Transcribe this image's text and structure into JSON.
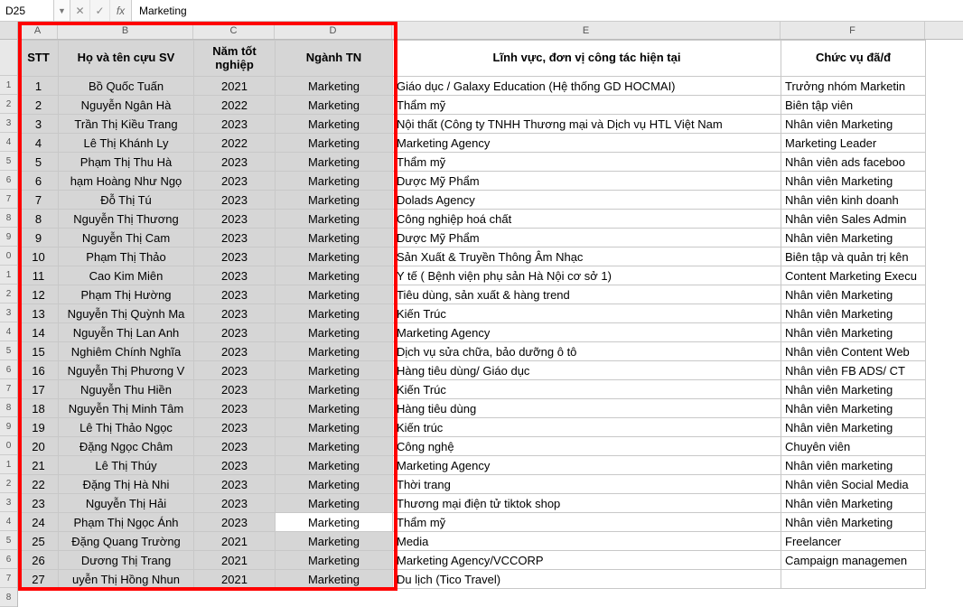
{
  "formula_bar": {
    "cell_ref": "D25",
    "fx_label": "fx",
    "value": "Marketing"
  },
  "columns": [
    "A",
    "B",
    "C",
    "D",
    "E",
    "F"
  ],
  "row_numbers": [
    "",
    "1",
    "2",
    "3",
    "4",
    "5",
    "6",
    "7",
    "8",
    "9",
    "0",
    "1",
    "2",
    "3",
    "4",
    "5",
    "6",
    "7",
    "8",
    "9",
    "0",
    "1",
    "2",
    "3",
    "4",
    "5",
    "6",
    "7",
    "8"
  ],
  "headers": {
    "stt": "STT",
    "name": "Họ và tên cựu SV",
    "year": "Năm tốt nghiệp",
    "major": "Ngành TN",
    "field": "Lĩnh vực, đơn vị công tác hiện tại",
    "position": "Chức vụ đã/đ"
  },
  "rows": [
    {
      "stt": "1",
      "name": "Bồ Quốc Tuấn",
      "year": "2021",
      "major": "Marketing",
      "field": "Giáo dục / Galaxy Education (Hệ thống GD HOCMAI)",
      "pos": "Trưởng nhóm Marketin"
    },
    {
      "stt": "2",
      "name": "Nguyễn Ngân Hà",
      "year": "2022",
      "major": "Marketing",
      "field": "Thẩm mỹ",
      "pos": "Biên tập viên"
    },
    {
      "stt": "3",
      "name": "Trần Thị Kiều Trang",
      "year": "2023",
      "major": "Marketing",
      "field": "Nội thất (Công ty TNHH Thương mại và Dịch vụ HTL Việt Nam",
      "pos": "Nhân viên Marketing"
    },
    {
      "stt": "4",
      "name": "Lê Thị Khánh Ly",
      "year": "2022",
      "major": "Marketing",
      "field": "Marketing Agency",
      "pos": "Marketing Leader"
    },
    {
      "stt": "5",
      "name": "Phạm Thị Thu Hà",
      "year": "2023",
      "major": "Marketing",
      "field": "Thẩm mỹ",
      "pos": "Nhân viên ads faceboo"
    },
    {
      "stt": "6",
      "name": "hạm Hoàng Như Ngọ",
      "year": "2023",
      "major": "Marketing",
      "field": "Dược Mỹ Phẩm",
      "pos": "Nhân viên Marketing"
    },
    {
      "stt": "7",
      "name": "Đỗ Thị Tú",
      "year": "2023",
      "major": "Marketing",
      "field": "Dolads Agency",
      "pos": "Nhân viên kinh doanh"
    },
    {
      "stt": "8",
      "name": "Nguyễn Thị Thương",
      "year": "2023",
      "major": "Marketing",
      "field": "Công nghiệp hoá chất",
      "pos": "Nhân viên Sales Admin"
    },
    {
      "stt": "9",
      "name": "Nguyễn Thị Cam",
      "year": "2023",
      "major": "Marketing",
      "field": "Dược Mỹ Phẩm",
      "pos": "Nhân viên Marketing"
    },
    {
      "stt": "10",
      "name": "Phạm Thị Thảo",
      "year": "2023",
      "major": "Marketing",
      "field": "Sản Xuất & Truyền Thông Âm Nhạc",
      "pos": "Biên tập và quản trị kên"
    },
    {
      "stt": "11",
      "name": "Cao Kim Miên",
      "year": "2023",
      "major": "Marketing",
      "field": "Y tế ( Bệnh viện phụ sản Hà Nội cơ sở 1)",
      "pos": "Content Marketing Execu"
    },
    {
      "stt": "12",
      "name": "Phạm Thị Hường",
      "year": "2023",
      "major": "Marketing",
      "field": "Tiêu dùng, sản xuất & hàng trend",
      "pos": "Nhân viên Marketing"
    },
    {
      "stt": "13",
      "name": "Nguyễn Thị Quỳnh Ma",
      "year": "2023",
      "major": "Marketing",
      "field": "Kiến Trúc",
      "pos": "Nhân viên Marketing"
    },
    {
      "stt": "14",
      "name": "Nguyễn Thị Lan Anh",
      "year": "2023",
      "major": "Marketing",
      "field": "Marketing Agency",
      "pos": "Nhân viên Marketing"
    },
    {
      "stt": "15",
      "name": "Nghiêm Chính Nghĩa",
      "year": "2023",
      "major": "Marketing",
      "field": "Dịch vụ sửa chữa, bảo dưỡng ô tô",
      "pos": "Nhân viên Content Web"
    },
    {
      "stt": "16",
      "name": "Nguyễn Thị Phương V",
      "year": "2023",
      "major": "Marketing",
      "field": "Hàng tiêu dùng/ Giáo dục",
      "pos": "Nhân viên FB ADS/ CT"
    },
    {
      "stt": "17",
      "name": "Nguyễn Thu Hiền",
      "year": "2023",
      "major": "Marketing",
      "field": "Kiến Trúc",
      "pos": "Nhân viên Marketing"
    },
    {
      "stt": "18",
      "name": "Nguyễn Thị Minh Tâm",
      "year": "2023",
      "major": "Marketing",
      "field": "Hàng tiêu dùng",
      "pos": "Nhân viên Marketing"
    },
    {
      "stt": "19",
      "name": "Lê Thị Thảo Ngọc",
      "year": "2023",
      "major": "Marketing",
      "field": "Kiến trúc",
      "pos": "Nhân viên Marketing"
    },
    {
      "stt": "20",
      "name": "Đặng Ngọc Châm",
      "year": "2023",
      "major": "Marketing",
      "field": "Công nghệ",
      "pos": "Chuyên viên"
    },
    {
      "stt": "21",
      "name": "Lê Thị Thúy",
      "year": "2023",
      "major": "Marketing",
      "field": "Marketing Agency",
      "pos": "Nhân viên marketing"
    },
    {
      "stt": "22",
      "name": "Đặng Thị Hà Nhi",
      "year": "2023",
      "major": "Marketing",
      "field": "Thời trang",
      "pos": "Nhân viên Social Media"
    },
    {
      "stt": "23",
      "name": "Nguyễn Thị Hải",
      "year": "2023",
      "major": "Marketing",
      "field": "Thương mại điện tử tiktok shop",
      "pos": "Nhân viên Marketing"
    },
    {
      "stt": "24",
      "name": "Phạm Thị Ngọc Ánh",
      "year": "2023",
      "major": "Marketing",
      "field": "Thẩm mỹ",
      "pos": "Nhân viên Marketing",
      "active": true
    },
    {
      "stt": "25",
      "name": "Đặng Quang Trường",
      "year": "2021",
      "major": "Marketing",
      "field": "Media",
      "pos": "Freelancer"
    },
    {
      "stt": "26",
      "name": "Dương Thị Trang",
      "year": "2021",
      "major": "Marketing",
      "field": "Marketing Agency/VCCORP",
      "pos": "Campaign managemen"
    },
    {
      "stt": "27",
      "name": "uyễn Thị Hồng Nhun",
      "year": "2021",
      "major": "Marketing",
      "field": "Du lịch (Tico Travel)",
      "pos": ""
    }
  ]
}
